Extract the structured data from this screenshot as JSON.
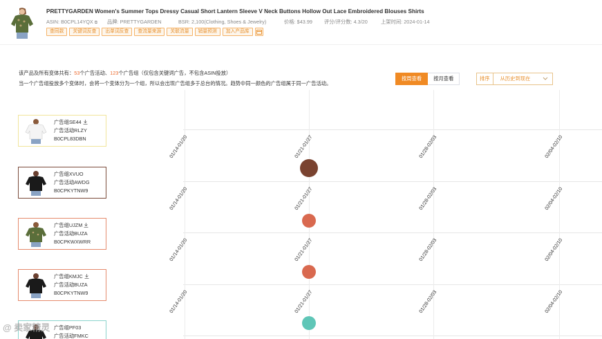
{
  "product": {
    "title": "PRETTYGARDEN Women's Summer Tops Dressy Casual Short Lantern Sleeve V Neck Buttons Hollow Out Lace Embroidered Blouses Shirts",
    "asin": "ASIN: B0CPL14YQX",
    "brand": "品牌: PRETTYGARDEN",
    "bsr": "BSR: 2,100(Clothing, Shoes & Jewelry)",
    "price": "价格: $43.99",
    "rating": "评分/评分数: 4.3/20",
    "launch_date": "上架时间: 2024-01-14",
    "tags": [
      "查同款",
      "关键词反查",
      "出单词反查",
      "查流量来源",
      "关联流量",
      "销量预测",
      "加入产品库"
    ]
  },
  "summary": {
    "line1_prefix": "该产品及所有变体共有：",
    "activity_count": "53",
    "line1_mid": "个广告活动、",
    "group_count": "123",
    "line1_suffix": "个广告组（仅包含关键词广告，不包含ASIN投放）",
    "line2": "当一个广告组投放多个变体时，会将一个变体分为一个组，所以会出现广告组多于总台的情况。趋势中同一颜色的广告组属于同一广告活动。"
  },
  "view_toggle": {
    "weekly": "按周查看",
    "monthly": "按月查看"
  },
  "sort": {
    "label": "排序",
    "value": "从历史到现在"
  },
  "ad_groups": [
    {
      "group": "广告组SE44",
      "campaign": "广告活动RLZY",
      "asin": "B0CPL83DBN",
      "border": "#f1e49a"
    },
    {
      "group": "广告组XVUO",
      "campaign": "广告活动AWDG",
      "asin": "B0CPKYTNW9",
      "border": "#7a4a3a"
    },
    {
      "group": "广告组UJZM",
      "campaign": "广告活动BUZA",
      "asin": "B0CPKWXWRR",
      "border": "#e58a6c"
    },
    {
      "group": "广告组KMJC",
      "campaign": "广告活动BUZA",
      "asin": "B0CPKYTNW9",
      "border": "#e58a6c"
    },
    {
      "group": "广告组PF03",
      "campaign": "广告活动FMKC",
      "asin": "",
      "border": "#8ad3cc"
    }
  ],
  "weeks": [
    "01/14-01/20",
    "01/21-01/27",
    "01/28-02/03",
    "02/04-02/10"
  ],
  "dots": [
    {
      "row": 1,
      "week": 1,
      "color": "#7a4330",
      "size": "large"
    },
    {
      "row": 2,
      "week": 1,
      "color": "#d9694f",
      "size": "medium"
    },
    {
      "row": 3,
      "week": 1,
      "color": "#d9694f",
      "size": "medium"
    },
    {
      "row": 4,
      "week": 1,
      "color": "#5fc6b7",
      "size": "medium"
    }
  ],
  "watermark": "@ 卖家精灵",
  "colors": {
    "accent": "#f08a24",
    "tag": "#e8912f"
  }
}
